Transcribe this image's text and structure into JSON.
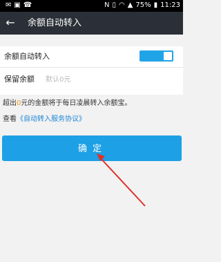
{
  "status_bar": {
    "battery_percent": "75%",
    "time": "11:23",
    "icons": [
      "mail-icon",
      "image-icon",
      "phone-icon",
      "nfc-icon",
      "vibrate-icon",
      "wifi-icon",
      "signal-icon",
      "battery-icon"
    ]
  },
  "app_bar": {
    "back_icon": "back-arrow-icon",
    "title": "余额自动转入"
  },
  "settings": {
    "auto_transfer_label": "余额自动转入",
    "auto_transfer_enabled": true,
    "reserve_label": "保留余额",
    "reserve_placeholder": "默认0元"
  },
  "note": {
    "prefix": "超出",
    "amount": "0",
    "suffix": "元的金额将于每日凌晨转入余额宝。"
  },
  "agreement": {
    "prefix": "查看",
    "link": "《自动转入服务协议》"
  },
  "confirm_button": "确定",
  "colors": {
    "accent": "#1da0e5",
    "appbar": "#2b2f37",
    "highlight": "#f09a14",
    "arrow": "#e0302a"
  }
}
